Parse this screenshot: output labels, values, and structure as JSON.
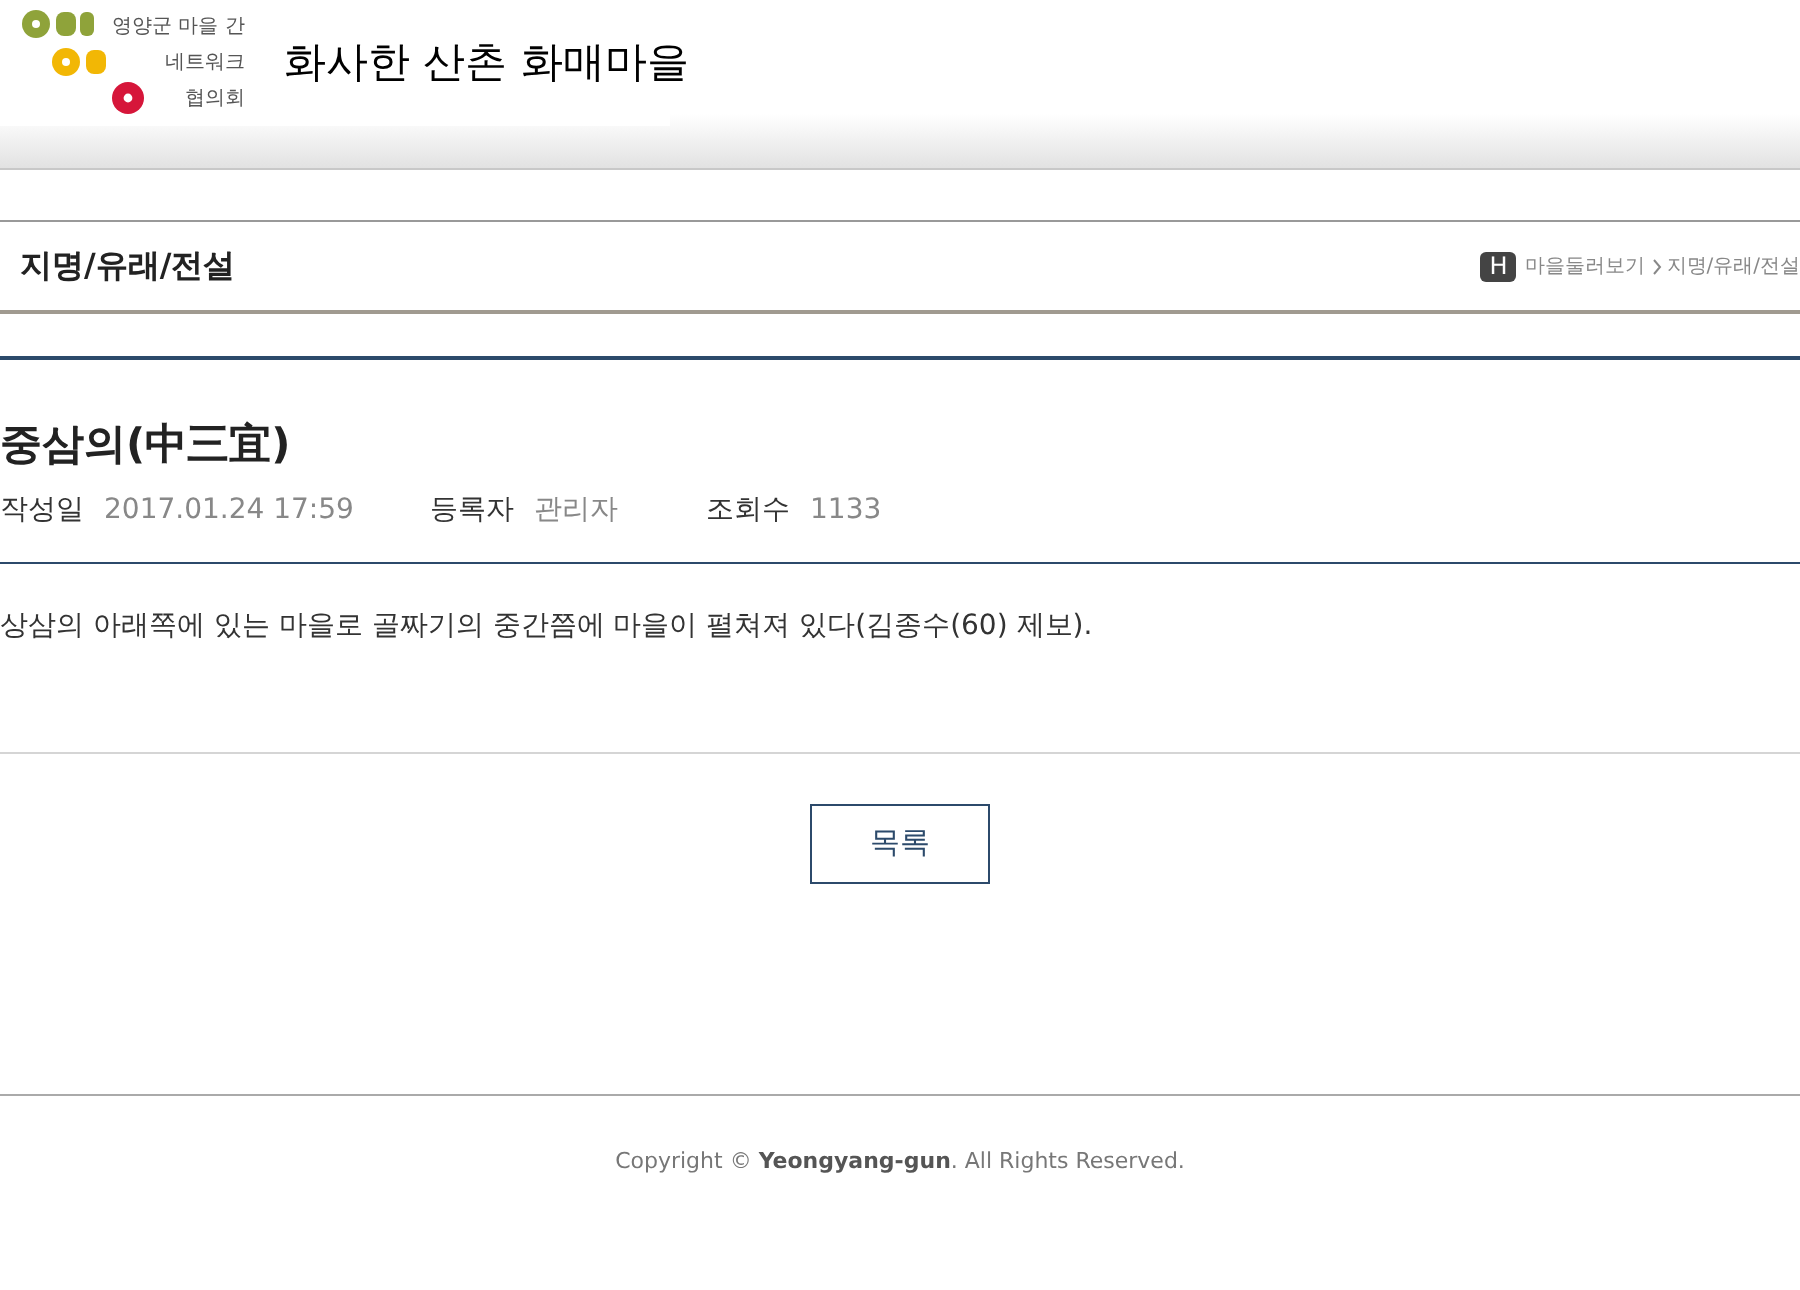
{
  "logo": {
    "lines": [
      "영양군 마을 간",
      "네트워크",
      "협의회"
    ]
  },
  "site_title": "화사한 산촌 화매마을",
  "section": {
    "title": "지명/유래/전설",
    "breadcrumb": {
      "home": "H",
      "items": [
        "마을둘러보기",
        "지명/유래/전설"
      ]
    }
  },
  "post": {
    "title": "중삼의(中三宜)",
    "meta": [
      {
        "label": "작성일",
        "value": "2017.01.24 17:59"
      },
      {
        "label": "등록자",
        "value": "관리자"
      },
      {
        "label": "조회수",
        "value": "1133"
      }
    ],
    "body": "상삼의 아래쪽에 있는 마을로 골짜기의 중간쯤에 마을이 펼쳐져 있다(김종수(60) 제보)."
  },
  "list_button": "목록",
  "footer": {
    "prefix": "Copyright © ",
    "brand": "Yeongyang-gun",
    "suffix": ". All Rights Reserved."
  }
}
